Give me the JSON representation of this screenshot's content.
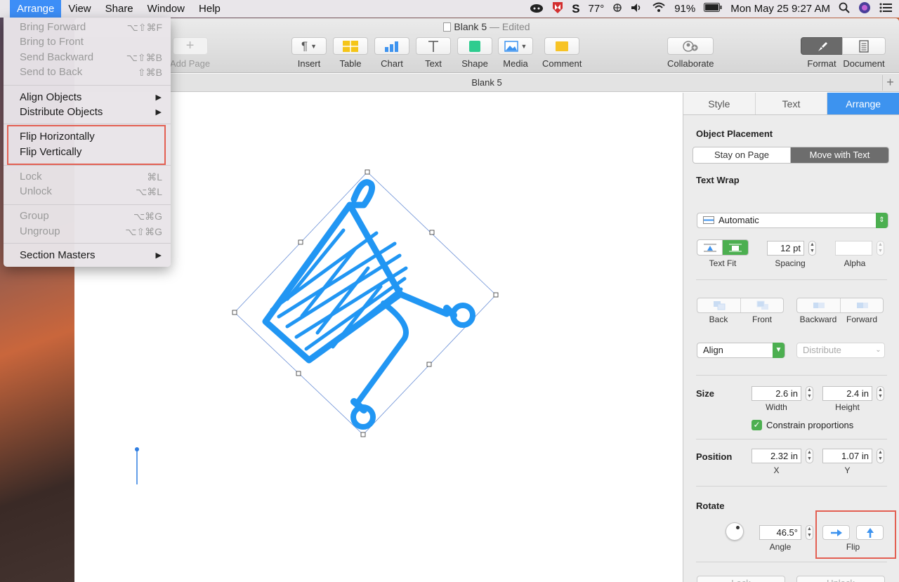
{
  "menubar": {
    "items": [
      "Arrange",
      "View",
      "Share",
      "Window",
      "Help"
    ],
    "temperature": "77°",
    "battery": "91%",
    "clock": "Mon May 25  9:27 AM"
  },
  "window": {
    "title": "Blank 5",
    "edited": "— Edited",
    "tab_title": "Blank 5"
  },
  "toolbar": {
    "add_page": "Add Page",
    "insert": "Insert",
    "table": "Table",
    "chart": "Chart",
    "text": "Text",
    "shape": "Shape",
    "media": "Media",
    "comment": "Comment",
    "collaborate": "Collaborate",
    "format": "Format",
    "document": "Document"
  },
  "arrange_menu": {
    "items": [
      {
        "label": "Bring Forward",
        "shortcut": "⌥⇧⌘F",
        "enabled": false
      },
      {
        "label": "Bring to Front",
        "shortcut": "",
        "enabled": false
      },
      {
        "label": "Send Backward",
        "shortcut": "⌥⇧⌘B",
        "enabled": false
      },
      {
        "label": "Send to Back",
        "shortcut": "⇧⌘B",
        "enabled": false
      },
      {
        "label": "Align Objects",
        "submenu": true,
        "enabled": true
      },
      {
        "label": "Distribute Objects",
        "submenu": true,
        "enabled": true
      },
      {
        "label": "Flip Horizontally",
        "enabled": true
      },
      {
        "label": "Flip Vertically",
        "enabled": true
      },
      {
        "label": "Lock",
        "shortcut": "⌘L",
        "enabled": false
      },
      {
        "label": "Unlock",
        "shortcut": "⌥⌘L",
        "enabled": false
      },
      {
        "label": "Group",
        "shortcut": "⌥⌘G",
        "enabled": false
      },
      {
        "label": "Ungroup",
        "shortcut": "⌥⇧⌘G",
        "enabled": false
      },
      {
        "label": "Section Masters",
        "submenu": true,
        "enabled": true
      }
    ]
  },
  "inspector": {
    "tabs": [
      "Style",
      "Text",
      "Arrange"
    ],
    "active_tab": "Arrange",
    "object_placement": {
      "title": "Object Placement",
      "options": [
        "Stay on Page",
        "Move with Text"
      ],
      "selected": "Move with Text"
    },
    "text_wrap": {
      "title": "Text Wrap",
      "value": "Automatic",
      "text_fit_label": "Text Fit",
      "spacing_value": "12 pt",
      "spacing_label": "Spacing",
      "alpha_value": "",
      "alpha_label": "Alpha"
    },
    "layer_buttons": [
      "Back",
      "Front",
      "Backward",
      "Forward"
    ],
    "align": {
      "value": "Align",
      "distribute": "Distribute"
    },
    "size": {
      "title": "Size",
      "width": "2.6 in",
      "width_label": "Width",
      "height": "2.4 in",
      "height_label": "Height",
      "constrain": "Constrain proportions"
    },
    "position": {
      "title": "Position",
      "x": "2.32 in",
      "x_label": "X",
      "y": "1.07 in",
      "y_label": "Y"
    },
    "rotate": {
      "title": "Rotate",
      "angle": "46.5°",
      "angle_label": "Angle",
      "flip_label": "Flip"
    },
    "lock": "Lock",
    "unlock": "Unlock"
  },
  "colors": {
    "accent": "#3d93ef",
    "cart": "#2196f3",
    "highlight": "#e35f52",
    "check": "#4caf50"
  }
}
